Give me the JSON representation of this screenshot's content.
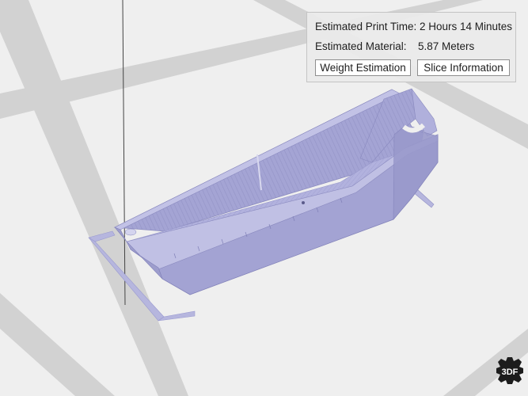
{
  "info_panel": {
    "print_time_label": "Estimated Print Time:",
    "print_time_value": "2 Hours 14 Minutes",
    "material_label": "Estimated Material:",
    "material_value": "5.87 Meters",
    "weight_button_label": "Weight Estimation",
    "slice_button_label": "Slice Information"
  },
  "watermark": {
    "text": "3DF"
  },
  "colors": {
    "background": "#efefef",
    "bed_grid": "#d0d0d0",
    "model_fill": "#a6a6d6",
    "model_dark": "#8c8cc0",
    "model_light": "#bdbde4",
    "skirt": "#b4b4dc"
  }
}
